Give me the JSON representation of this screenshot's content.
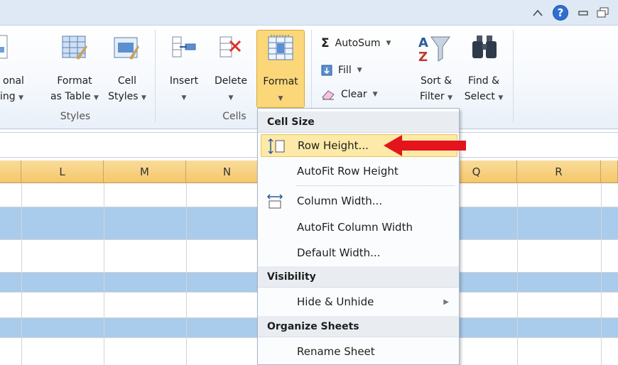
{
  "ribbon": {
    "conditional": {
      "line1": "onal",
      "line2": "ing"
    },
    "format_table": {
      "line1": "Format",
      "line2": "as Table"
    },
    "cell_styles": {
      "line1": "Cell",
      "line2": "Styles"
    },
    "insert": {
      "label": "Insert"
    },
    "delete": {
      "label": "Delete"
    },
    "format": {
      "label": "Format"
    },
    "autosum": {
      "label": "AutoSum"
    },
    "fill": {
      "label": "Fill"
    },
    "clear": {
      "label": "Clear"
    },
    "sort_filter": {
      "line1": "Sort &",
      "line2": "Filter"
    },
    "find_select": {
      "line1": "Find &",
      "line2": "Select"
    },
    "groups": {
      "styles": "Styles",
      "cells": "Cells"
    },
    "icons": [
      "table-format-icon",
      "cell-styles-icon",
      "insert-cells-icon",
      "delete-cells-icon",
      "format-cells-icon",
      "sigma-icon",
      "fill-down-icon",
      "eraser-icon",
      "sort-filter-icon",
      "binoculars-icon"
    ]
  },
  "columns": [
    "L",
    "M",
    "N",
    "Q",
    "R"
  ],
  "menu": {
    "cell_size_header": "Cell Size",
    "row_height": "Row Height...",
    "autofit_row_height": "AutoFit Row Height",
    "column_width": "Column Width...",
    "autofit_column_width": "AutoFit Column Width",
    "default_width": "Default Width...",
    "visibility_header": "Visibility",
    "hide_unhide": "Hide & Unhide",
    "organize_header": "Organize Sheets",
    "rename_sheet": "Rename Sheet"
  },
  "colors": {
    "accent_hover": "#fde9a8",
    "selected_row": "#a9cbec",
    "column_header": "#f5c76a",
    "annotation_arrow": "#e3141b"
  }
}
